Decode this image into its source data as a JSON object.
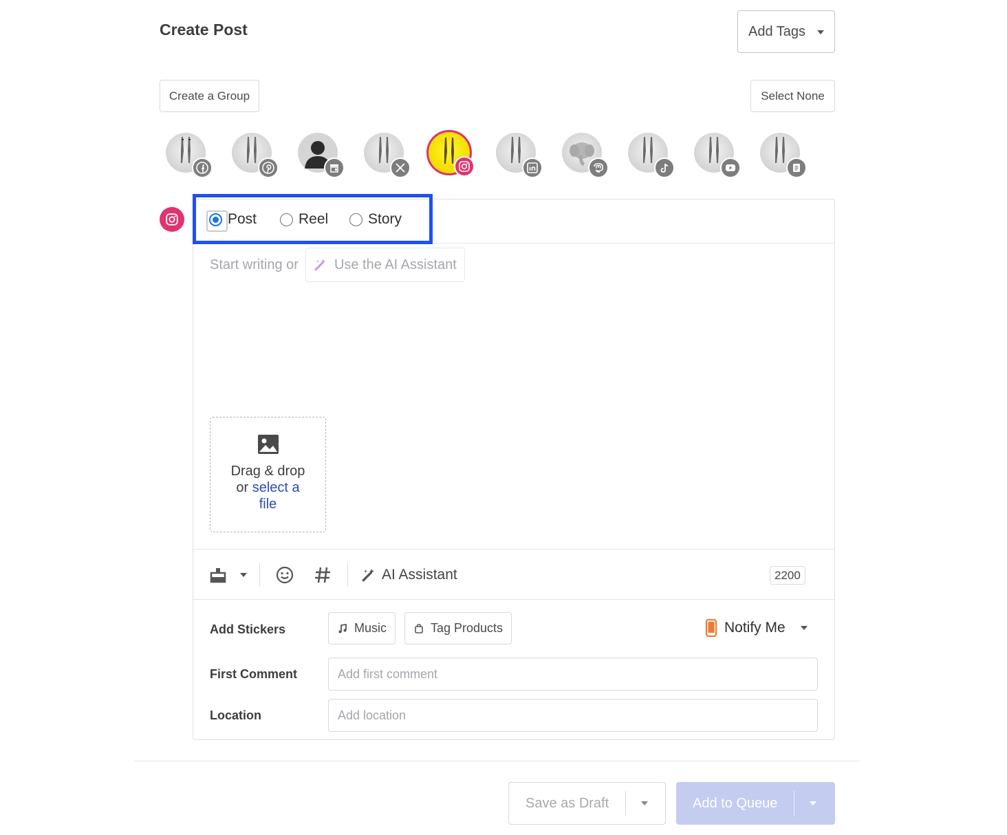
{
  "header": {
    "title": "Create Post",
    "add_tags_label": "Add Tags"
  },
  "group_actions": {
    "create_group_label": "Create a Group",
    "select_none_label": "Select None"
  },
  "accounts": [
    {
      "network": "facebook",
      "icon": "facebook-icon",
      "selected": false
    },
    {
      "network": "pinterest",
      "icon": "pinterest-icon",
      "selected": false
    },
    {
      "network": "google-business",
      "icon": "storefront-icon",
      "selected": false
    },
    {
      "network": "x",
      "icon": "x-icon",
      "selected": false
    },
    {
      "network": "instagram",
      "icon": "instagram-icon",
      "selected": true
    },
    {
      "network": "linkedin",
      "icon": "linkedin-icon",
      "selected": false
    },
    {
      "network": "mastodon",
      "icon": "mastodon-icon",
      "selected": false
    },
    {
      "network": "tiktok",
      "icon": "tiktok-icon",
      "selected": false
    },
    {
      "network": "youtube",
      "icon": "youtube-icon",
      "selected": false
    },
    {
      "network": "start-page",
      "icon": "start-page-icon",
      "selected": false
    }
  ],
  "post_type": {
    "options": [
      {
        "label": "Post",
        "checked": true
      },
      {
        "label": "Reel",
        "checked": false
      },
      {
        "label": "Story",
        "checked": false
      }
    ]
  },
  "editor": {
    "placeholder_prefix": "Start writing or",
    "ai_assistant_chip": "Use the AI Assistant",
    "dropzone_line1": "Drag & drop",
    "dropzone_or": "or",
    "dropzone_link_1": "select a",
    "dropzone_link_2": "file"
  },
  "toolbar": {
    "ai_assistant_label": "AI Assistant",
    "char_count": "2200"
  },
  "fields": {
    "stickers_label": "Add Stickers",
    "music_label": "Music",
    "tag_products_label": "Tag Products",
    "notify_label": "Notify Me",
    "first_comment_label": "First Comment",
    "first_comment_placeholder": "Add first comment",
    "location_label": "Location",
    "location_placeholder": "Add location"
  },
  "footer": {
    "save_draft_label": "Save as Draft",
    "add_queue_label": "Add to Queue"
  },
  "colors": {
    "instagram": "#e0336f",
    "highlight": "#1f4ff5",
    "radio": "#1a73e8",
    "link": "#2c4bb8",
    "queue_button": "#c4ccf0"
  }
}
